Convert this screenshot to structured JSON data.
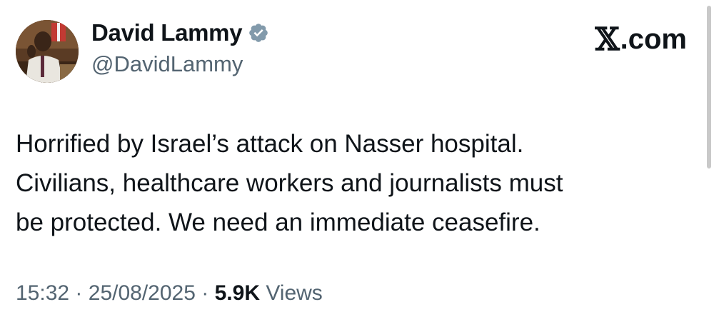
{
  "author": {
    "display_name": "David Lammy",
    "handle": "@DavidLammy",
    "verified": true
  },
  "brand": {
    "mark": "𝕏",
    "label": ".com"
  },
  "tweet": {
    "lines": [
      "Horrified by Israel’s attack on Nasser hospital.",
      "Civilians, healthcare workers and journalists must",
      "be protected. We need an immediate ceasefire."
    ]
  },
  "meta": {
    "time": "15:32",
    "separator": "·",
    "date": "25/08/2025",
    "views_count": "5.9K",
    "views_label": "Views"
  },
  "colors": {
    "text_primary": "#0f1419",
    "text_secondary": "#536471",
    "verified_badge": "#829aab"
  },
  "icons": {
    "verified": "verified-badge-icon",
    "avatar": "profile-photo"
  }
}
